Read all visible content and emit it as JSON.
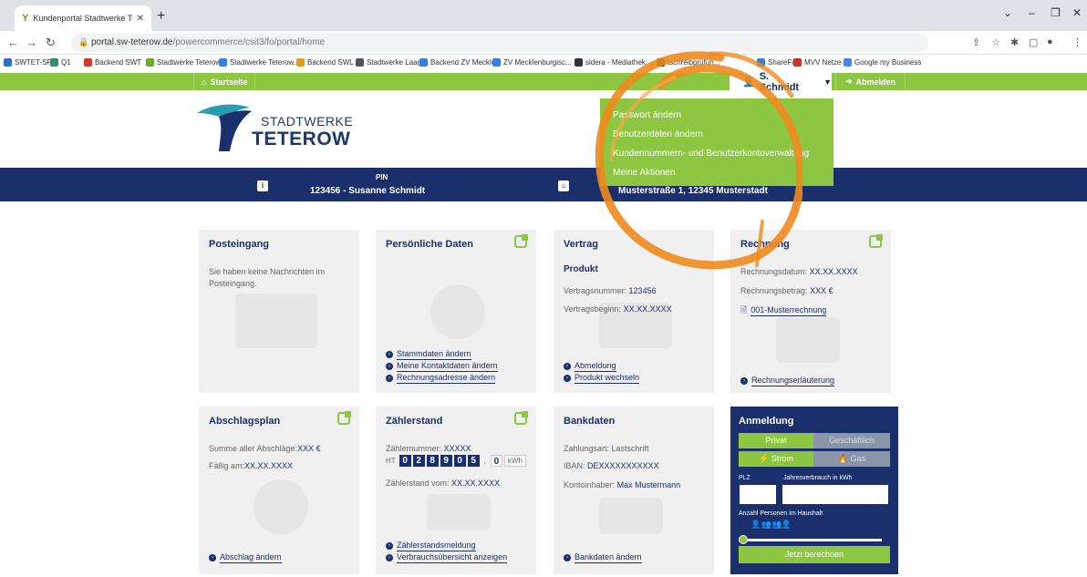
{
  "browser": {
    "tab_title": "Kundenportal Stadtwerke Teteroi",
    "url_host": "portal.sw-teterow.de",
    "url_path": "/powercommerce/csit3/fo/portal/home",
    "bookmarks": [
      {
        "label": "SWTET-SPS",
        "color": "#2f6fc9"
      },
      {
        "label": "Q1",
        "color": "#2f8f6e"
      },
      {
        "label": "Backend SWT",
        "color": "#d33a2c"
      },
      {
        "label": "Stadtwerke Teterow...",
        "color": "#6aa82e"
      },
      {
        "label": "Stadtwerke Teterow...",
        "color": "#3b7dd8"
      },
      {
        "label": "Backend SWL",
        "color": "#e0a01c"
      },
      {
        "label": "Stadtwerke Laage",
        "color": "#555555"
      },
      {
        "label": "Backend ZV Meckle...",
        "color": "#3b7dd8"
      },
      {
        "label": "ZV Mecklenburgisc...",
        "color": "#3b7dd8"
      },
      {
        "label": "sldera - Mediathek",
        "color": "#333333"
      },
      {
        "label": "tschreibprüfun...",
        "color": "#222222"
      },
      {
        "label": "ShareFile",
        "color": "#3b7dd8"
      },
      {
        "label": "MVV Netze",
        "color": "#c0392b"
      },
      {
        "label": "Google my Business",
        "color": "#4285f4"
      }
    ]
  },
  "nav": {
    "home": "Startseite",
    "user": "S. Schmidt",
    "logout": "Abmelden"
  },
  "logo": {
    "line1": "STADTWERKE",
    "line2": "TETEROW"
  },
  "dropdown": {
    "items": [
      "Passwort ändern",
      "Benutzerdaten ändern",
      "Kundennummern- und Benutzerkontoverwaltung",
      "Meine Aktionen"
    ]
  },
  "info": {
    "pin_label": "PIN",
    "pin_value": "123456 - Susanne Schmidt",
    "address": "Musterstraße 1, 12345 Musterstadt"
  },
  "cards": {
    "posteingang": {
      "title": "Posteingang",
      "text1": "Sie haben keine Nachrichten im",
      "text2": "Posteingang."
    },
    "persoenlich": {
      "title": "Persönliche Daten",
      "links": [
        "Stammdaten ändern",
        "Meine Kontaktdaten ändern",
        "Rechnungsadresse ändern"
      ]
    },
    "vertrag": {
      "title": "Vertrag",
      "product": "Produkt",
      "nr_label": "Vertragsnummer:",
      "nr_value": "123456",
      "begin_label": "Vertragsbeginn:",
      "begin_value": "XX.XX.XXXX",
      "links": [
        "Abmeldung",
        "Produkt wechseln"
      ]
    },
    "rechnung": {
      "title": "Rechnung",
      "date_label": "Rechnungsdatum:",
      "date_value": "XX.XX.XXXX",
      "amount_label": "Rechnungsbetrag:",
      "amount_value": "XXX €",
      "file": "001-Musterrechnung",
      "link": "Rechnungserläuterung"
    },
    "abschlag": {
      "title": "Abschlagsplan",
      "sum_label": "Summe aller Abschläge:",
      "sum_value": "XXX €",
      "due_label": "Fällig am:",
      "due_value": "XX.XX.XXXX",
      "link": "Abschlag ändern"
    },
    "zaehler": {
      "title": "Zählerstand",
      "nr_label": "Zählernummer:",
      "nr_value": "XXXXX",
      "meter_prefix": "HT",
      "digits": [
        "0",
        "2",
        "8",
        "9",
        "0",
        "5"
      ],
      "decimal": "0",
      "unit": "kWh",
      "date_label": "Zählerstand vom:",
      "date_value": "XX.XX.XXXX",
      "links": [
        "Zählerstandsmeldung",
        "Verbrauchsübersicht anzeigen"
      ]
    },
    "bank": {
      "title": "Bankdaten",
      "type_label": "Zahlungsart:",
      "type_value": "Lastschrift",
      "iban_label": "IBAN:",
      "iban_value": "DEXXXXXXXXXXX",
      "owner_label": "Kontoinhaber:",
      "owner_value": "Max Mustermann",
      "link": "Bankdaten ändern"
    }
  },
  "anmeldung": {
    "title": "Anmeldung",
    "tab_private": "Privat",
    "tab_business": "Geschäftlich",
    "tab_power": "Strom",
    "tab_gas": "Gas",
    "plz_label": "PLZ",
    "consumption_label": "Jahresverbrauch in kWh",
    "persons_label": "Anzahl Personen im Haushalt",
    "button": "Jetzt berechnen"
  },
  "colors": {
    "green": "#8dc641",
    "navy": "#1a2f6b",
    "highlight": "#f08a1e"
  }
}
